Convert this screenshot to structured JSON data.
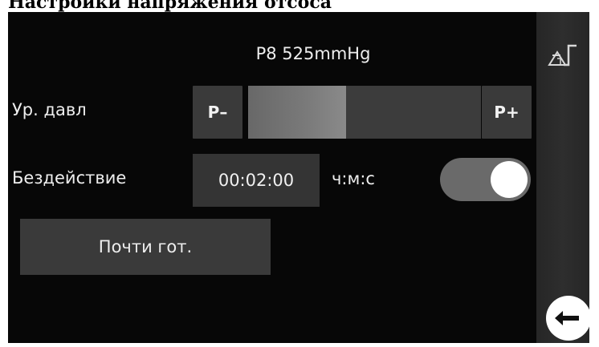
{
  "document": {
    "heading": "Настройки напряжения отсоса"
  },
  "screen": {
    "pressure_title": "P8 525mmHg",
    "pressure_level": {
      "label": "Ур. давл",
      "minus_label": "P–",
      "plus_label": "P+",
      "fill_fraction": 0.42
    },
    "idle": {
      "label": "Бездействие",
      "time_value": "00:02:00",
      "time_unit": "ч:м:с",
      "toggle_on": true
    },
    "almost_ready_label": "Почти гот."
  },
  "sidebar": {
    "icons": [
      "delta-pressure-icon",
      "back-arrow-icon"
    ]
  },
  "colors": {
    "background": "#070707",
    "button": "#3a3a3a",
    "slider_fill": "#7a7a7a",
    "toggle_track": "#6a6a6a",
    "text": "#eeeeee"
  }
}
